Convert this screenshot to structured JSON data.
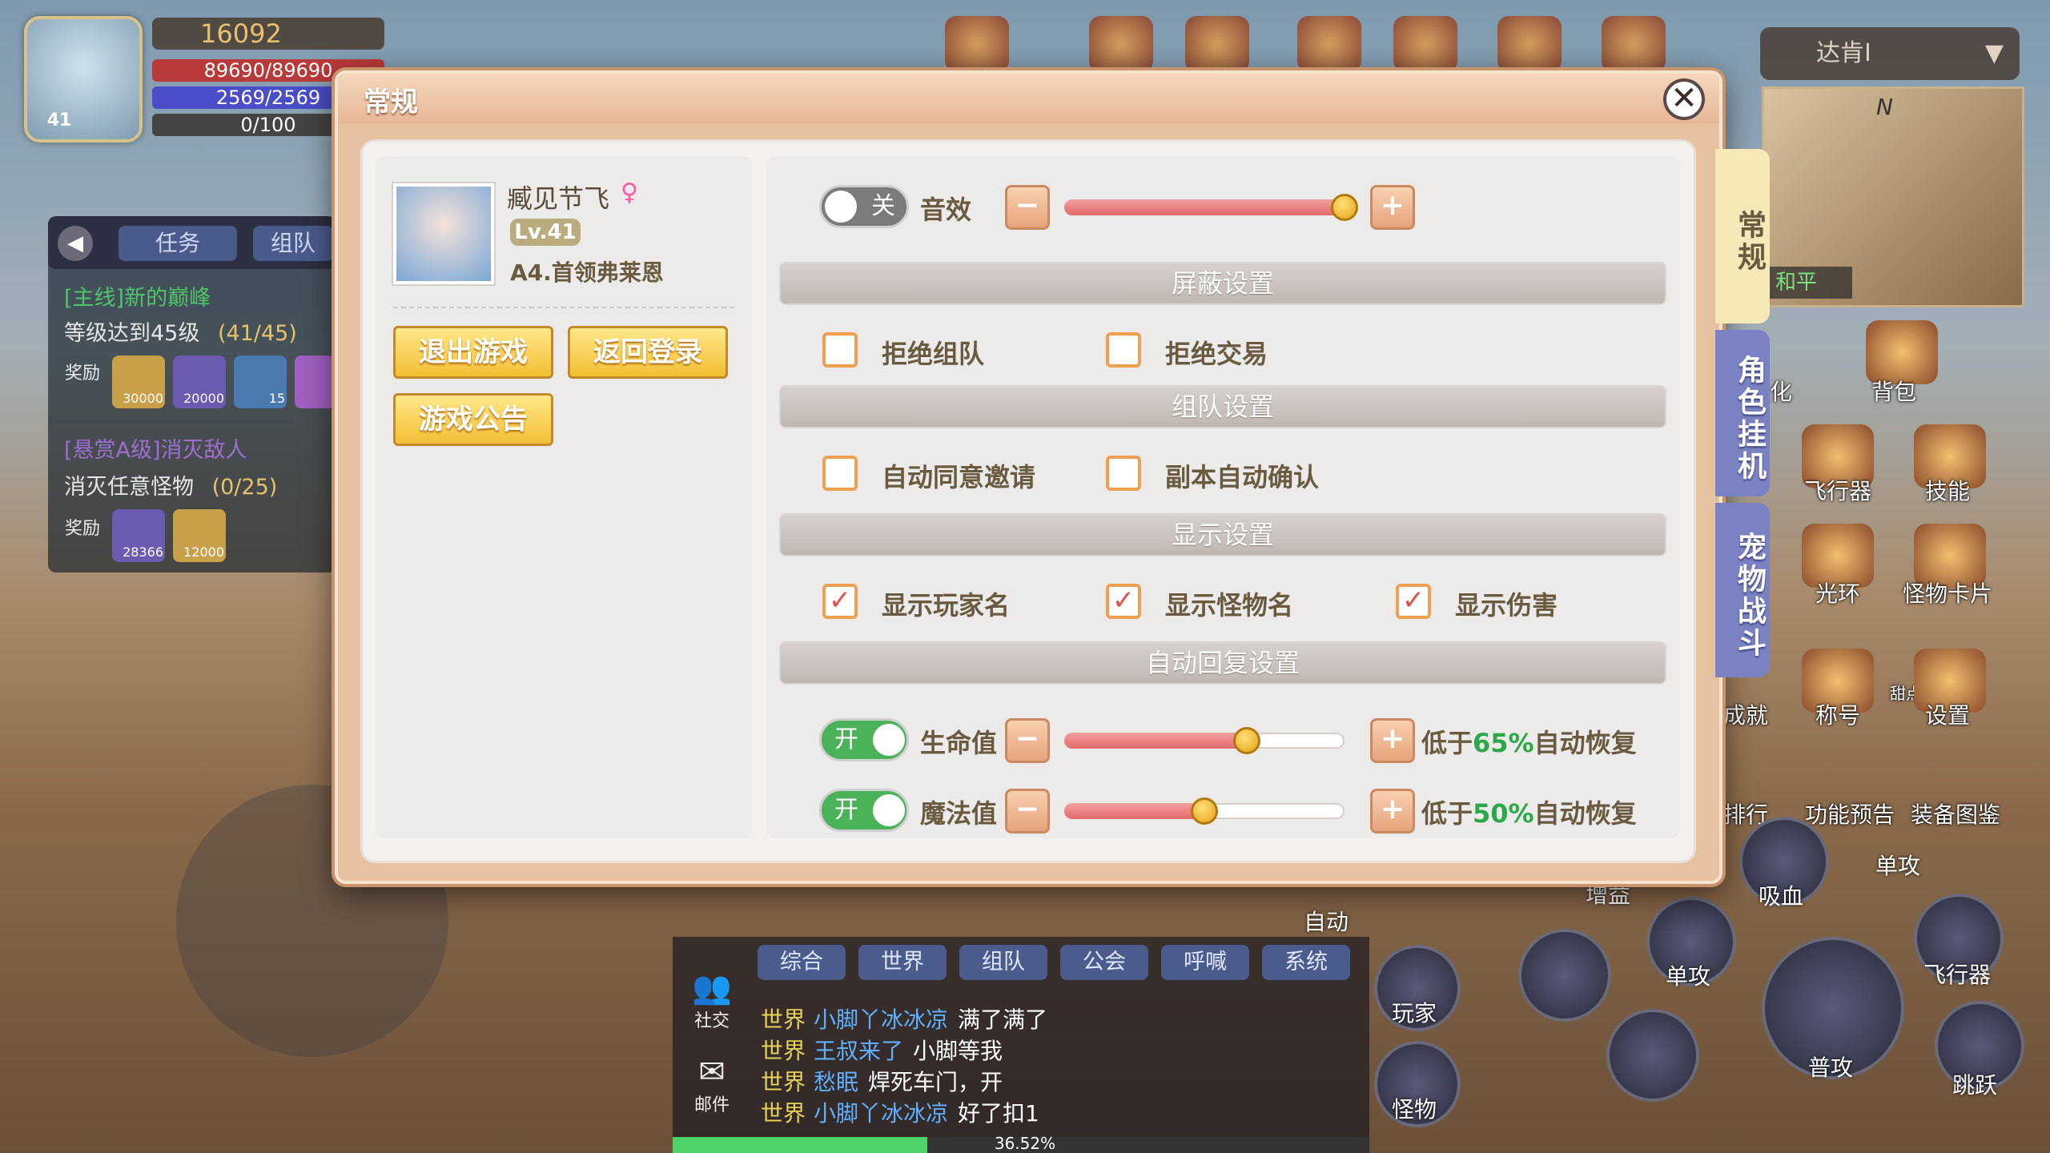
{
  "hud": {
    "gold": "16092",
    "hp": "89690/89690",
    "mp": "2569/2569",
    "xp": "0/100",
    "level": "41"
  },
  "quest": {
    "tab_task": "任务",
    "tab_team": "组队",
    "main_title": "[主线]新的巅峰",
    "main_desc": "等级达到45级",
    "main_progress": "(41/45)",
    "main_reward_1": "30000",
    "main_reward_2": "20000",
    "main_reward_3": "15",
    "reward_label": "奖励",
    "bounty_title": "[悬赏A级]消灭敌人",
    "bounty_desc": "消灭任意怪物",
    "bounty_progress": "(0/25)",
    "bounty_reward_1": "28366",
    "bounty_reward_2": "12000"
  },
  "top": {
    "server": "达肯I",
    "minimap_mode": "和平",
    "minimap_north": "N"
  },
  "dialog": {
    "title": "常规",
    "close_glyph": "✕",
    "profile": {
      "name": "臧见节飞",
      "gender_glyph": "♀",
      "level": "Lv.41",
      "title": "A4.首领弗莱恩"
    },
    "buttons": {
      "exit_game": "退出游戏",
      "return_login": "返回登录",
      "notice": "游戏公告"
    },
    "sound": {
      "toggle_state": "关",
      "label": "音效",
      "level": 1.0
    },
    "sections": {
      "block": "屏蔽设置",
      "team": "组队设置",
      "display": "显示设置",
      "recover": "自动回复设置"
    },
    "block_options": [
      {
        "label": "拒绝组队",
        "checked": false
      },
      {
        "label": "拒绝交易",
        "checked": false
      }
    ],
    "team_options": [
      {
        "label": "自动同意邀请",
        "checked": false
      },
      {
        "label": "副本自动确认",
        "checked": false
      }
    ],
    "display_options": [
      {
        "label": "显示玩家名",
        "checked": true
      },
      {
        "label": "显示怪物名",
        "checked": true
      },
      {
        "label": "显示伤害",
        "checked": true
      }
    ],
    "check_glyph": "✓",
    "recover": {
      "hp": {
        "toggle": "开",
        "label": "生命值",
        "prefix": "低于",
        "pct": "65%",
        "suffix": "自动恢复",
        "level": 0.65
      },
      "mp": {
        "toggle": "开",
        "label": "魔法值",
        "prefix": "低于",
        "pct": "50%",
        "suffix": "自动恢复",
        "level": 0.5
      }
    },
    "minus": "−",
    "plus": "+"
  },
  "side_tabs": {
    "general": "常规",
    "hangup": "角色挂机",
    "pet": "宠物战斗"
  },
  "right_menu": {
    "bag": "背包",
    "aircraft": "飞行器",
    "skill": "技能",
    "halo": "光环",
    "monster_card": "怪物卡片",
    "title": "称号",
    "settings": "设置",
    "achievement": "成就",
    "rank": "排行",
    "preview": "功能预告",
    "equip_book": "装备图鉴",
    "strengthen": "强化",
    "sweet": "甜点"
  },
  "skills": {
    "auto": "自动",
    "player": "玩家",
    "monster": "怪物",
    "buff": "增益",
    "single1": "单攻",
    "single2": "单攻",
    "lifesteal": "吸血",
    "aircraft": "飞行器",
    "normal_attack": "普攻",
    "jump": "跳跃"
  },
  "chat": {
    "tabs": [
      "综合",
      "世界",
      "组队",
      "公会",
      "呼喊",
      "系统"
    ],
    "social": "社交",
    "mail": "邮件",
    "lines": [
      {
        "channel": "世界",
        "name": "小脚丫冰冰凉",
        "text": "满了满了"
      },
      {
        "channel": "世界",
        "name": "王叔来了",
        "text": "小脚等我"
      },
      {
        "channel": "世界",
        "name": "愁眠",
        "text": "焊死车门，开"
      },
      {
        "channel": "世界",
        "name": "小脚丫冰冰凉",
        "text": "好了扣1"
      }
    ],
    "exp_pct": "36.52%",
    "exp_level": 0.3652
  },
  "colors": {
    "dialog_bg": "#e7c2a0",
    "gold_button": "#f3bf34",
    "toggle_on": "#4bb25a",
    "toggle_off": "#7b7b7b",
    "checkbox_border": "#f0a050",
    "check_mark": "#e0524a",
    "percent_text": "#2ca84a",
    "slider_fill": "#e26a6a",
    "side_tab_active": "#f7e8b8",
    "side_tab_inactive": "#7b82c4"
  }
}
